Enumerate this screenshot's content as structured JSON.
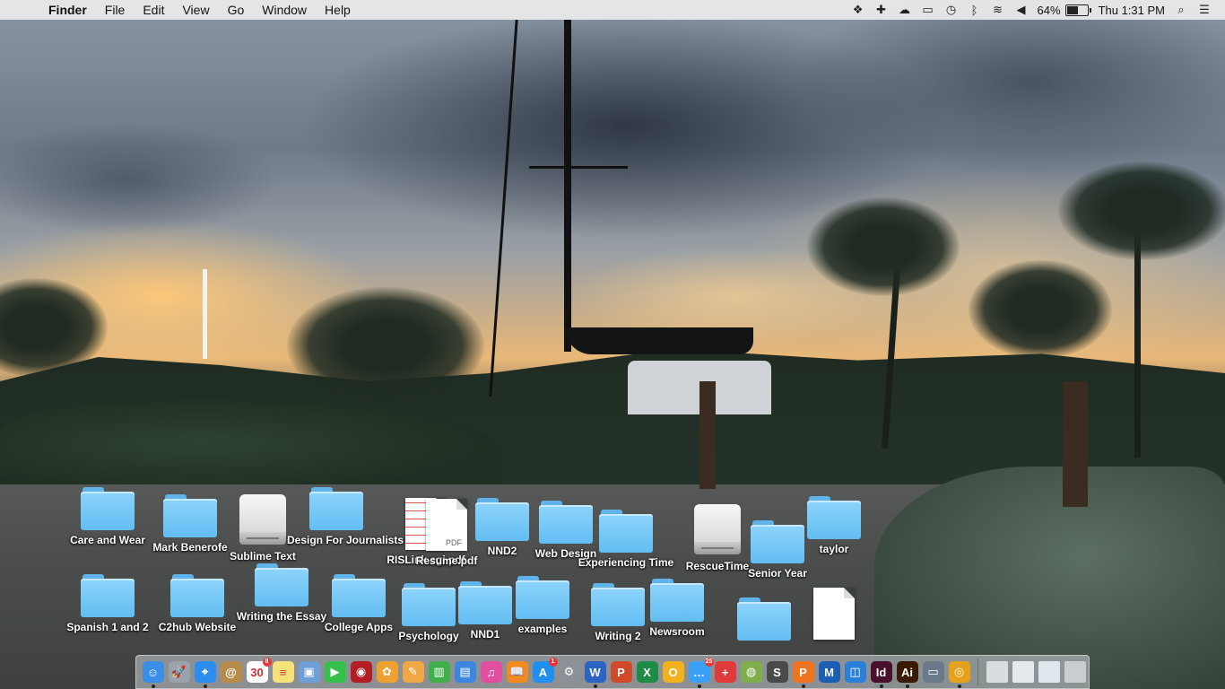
{
  "menubar": {
    "app_name": "Finder",
    "menus": [
      "File",
      "Edit",
      "View",
      "Go",
      "Window",
      "Help"
    ],
    "battery_percent": "64%",
    "battery_level": 0.64,
    "clock": "Thu 1:31 PM",
    "status_icons": [
      "dropbox-icon",
      "plus-cross-icon",
      "cloud-sync-icon",
      "airplay-icon",
      "time-machine-icon",
      "bluetooth-icon",
      "wifi-icon",
      "volume-icon",
      "battery-icon",
      "spotlight-search-icon",
      "notification-center-icon"
    ]
  },
  "desktop": {
    "items": [
      {
        "name": "Care and Wear",
        "type": "folder"
      },
      {
        "name": "Mark Benerofe",
        "type": "folder"
      },
      {
        "name": "Sublime Text",
        "type": "drive"
      },
      {
        "name": "Design For Journalists",
        "type": "folder"
      },
      {
        "name": "RISLink.cgi.pdf",
        "type": "document"
      },
      {
        "name": "Resume.pdf",
        "type": "pdf"
      },
      {
        "name": "NND2",
        "type": "folder"
      },
      {
        "name": "Web Design",
        "type": "folder"
      },
      {
        "name": "Experiencing Time",
        "type": "folder"
      },
      {
        "name": "RescueTime",
        "type": "drive"
      },
      {
        "name": "Senior Year",
        "type": "folder"
      },
      {
        "name": "taylor",
        "type": "folder"
      },
      {
        "name": "Spanish 1 and 2",
        "type": "folder"
      },
      {
        "name": "C2hub Website",
        "type": "folder"
      },
      {
        "name": "Writing the Essay",
        "type": "folder"
      },
      {
        "name": "College Apps",
        "type": "folder"
      },
      {
        "name": "Psychology",
        "type": "folder"
      },
      {
        "name": "NND1",
        "type": "folder"
      },
      {
        "name": "examples",
        "type": "folder"
      },
      {
        "name": "Writing 2",
        "type": "folder"
      },
      {
        "name": "Newsroom",
        "type": "folder"
      },
      {
        "name": "",
        "type": "folder"
      },
      {
        "name": "",
        "type": "document"
      }
    ]
  },
  "dock": {
    "apps": [
      {
        "name": "finder-icon",
        "glyph": "☺",
        "color": "#3a8ee6",
        "running": true
      },
      {
        "name": "launchpad-icon",
        "glyph": "🚀",
        "color": "#9aa2ad",
        "running": false
      },
      {
        "name": "safari-icon",
        "glyph": "⌖",
        "color": "#2c8df0",
        "running": true
      },
      {
        "name": "contacts-icon",
        "glyph": "@",
        "color": "#b88b4a",
        "running": false
      },
      {
        "name": "calendar-icon",
        "glyph": "30",
        "color": "#ffffff",
        "running": false,
        "badge": "8"
      },
      {
        "name": "notes-icon",
        "glyph": "≡",
        "color": "#f6e27a",
        "running": false
      },
      {
        "name": "preview-icon",
        "glyph": "▣",
        "color": "#6f9fd8",
        "running": false
      },
      {
        "name": "facetime-icon",
        "glyph": "▶",
        "color": "#35c04c",
        "running": false
      },
      {
        "name": "photo-booth-icon",
        "glyph": "◉",
        "color": "#b31e24",
        "running": false
      },
      {
        "name": "photos-icon",
        "glyph": "✿",
        "color": "#f0a030",
        "running": false
      },
      {
        "name": "pages-icon",
        "glyph": "✎",
        "color": "#f0a845",
        "running": false
      },
      {
        "name": "numbers-icon",
        "glyph": "▥",
        "color": "#3fb04b",
        "running": false
      },
      {
        "name": "keynote-icon",
        "glyph": "▤",
        "color": "#3d86e0",
        "running": false
      },
      {
        "name": "itunes-icon",
        "glyph": "♫",
        "color": "#e24fa0",
        "running": false
      },
      {
        "name": "ibooks-icon",
        "glyph": "📖",
        "color": "#f28b1f",
        "running": false
      },
      {
        "name": "app-store-icon",
        "glyph": "A",
        "color": "#1f8ff0",
        "running": false,
        "badge": "1"
      },
      {
        "name": "system-preferences-icon",
        "glyph": "⚙",
        "color": "#8d9096",
        "running": false
      },
      {
        "name": "word-icon",
        "glyph": "W",
        "color": "#2b64c4",
        "running": true
      },
      {
        "name": "powerpoint-icon",
        "glyph": "P",
        "color": "#d04a2a",
        "running": false
      },
      {
        "name": "excel-icon",
        "glyph": "X",
        "color": "#1e8c45",
        "running": false
      },
      {
        "name": "outlook-icon",
        "glyph": "O",
        "color": "#f2b21d",
        "running": false
      },
      {
        "name": "messages-icon",
        "glyph": "…",
        "color": "#3aa0f5",
        "running": true,
        "badge": "25"
      },
      {
        "name": "hospital-cross-icon",
        "glyph": "+",
        "color": "#e23a3a",
        "running": false
      },
      {
        "name": "network-icon",
        "glyph": "◍",
        "color": "#7fae4a",
        "running": false
      },
      {
        "name": "sublime-text-icon",
        "glyph": "S",
        "color": "#4a4a4a",
        "running": false
      },
      {
        "name": "pdf-app-icon",
        "glyph": "P",
        "color": "#f07320",
        "running": true
      },
      {
        "name": "mendeley-icon",
        "glyph": "M",
        "color": "#1a5fb4",
        "running": false
      },
      {
        "name": "simplenote-icon",
        "glyph": "◫",
        "color": "#2a7fd6",
        "running": false
      },
      {
        "name": "indesign-icon",
        "glyph": "Id",
        "color": "#4a0f2a",
        "running": true
      },
      {
        "name": "illustrator-icon",
        "glyph": "Ai",
        "color": "#3a1a05",
        "running": true
      },
      {
        "name": "image-capture-icon",
        "glyph": "▭",
        "color": "#6a7a8a",
        "running": false
      },
      {
        "name": "chrome-icon",
        "glyph": "◎",
        "color": "#e6a11a",
        "running": true
      }
    ],
    "stack_items": [
      {
        "name": "downloads-stack-icon",
        "color": "#d8dde2"
      },
      {
        "name": "documents-stack-icon",
        "color": "#e6eaee"
      },
      {
        "name": "screenshots-stack-icon",
        "color": "#dfe6ee"
      },
      {
        "name": "trash-icon",
        "color": "#c9cdd1"
      }
    ]
  }
}
